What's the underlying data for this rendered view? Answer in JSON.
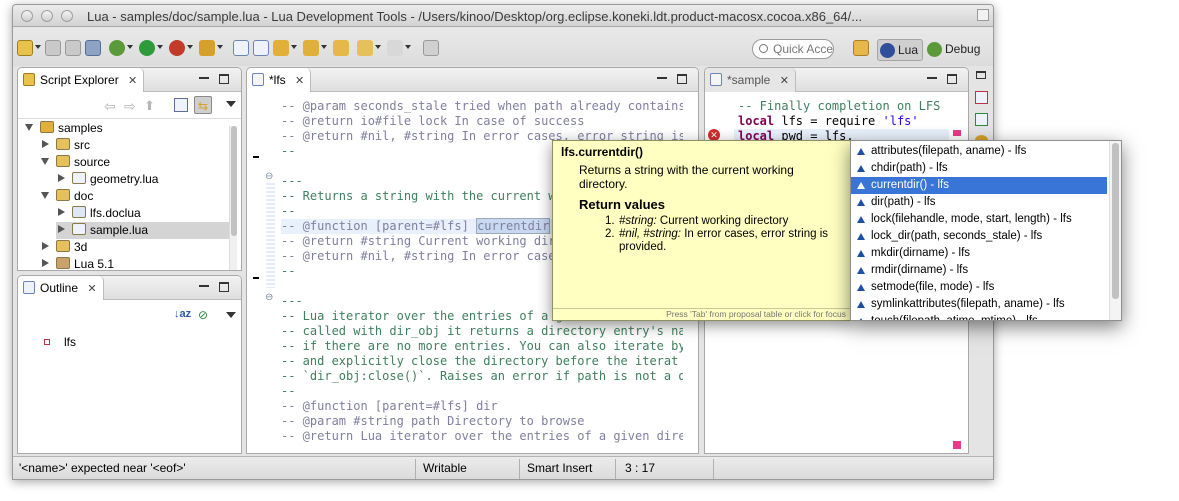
{
  "window": {
    "title": "Lua - samples/doc/sample.lua - Lua Development Tools - /Users/kinoo/Desktop/org.eclipse.koneki.ldt.product-macosx.cocoa.x86_64/..."
  },
  "toolbar": {
    "quick_access_placeholder": "Quick Acce",
    "perspectives": [
      {
        "label": "Lua",
        "icon": "lua-perspective-icon"
      },
      {
        "label": "Debug",
        "icon": "debug-bug-icon"
      }
    ]
  },
  "script_explorer": {
    "tab_label": "Script Explorer",
    "tree": [
      {
        "label": "samples",
        "depth": 0,
        "state": "open",
        "icon": "project-folder-icon"
      },
      {
        "label": "src",
        "depth": 1,
        "state": "closed",
        "icon": "source-folder-icon"
      },
      {
        "label": "source",
        "depth": 1,
        "state": "open",
        "icon": "source-folder-icon"
      },
      {
        "label": "geometry.lua",
        "depth": 2,
        "state": "closed",
        "icon": "lua-file-icon"
      },
      {
        "label": "doc",
        "depth": 1,
        "state": "open",
        "icon": "source-folder-icon"
      },
      {
        "label": "lfs.doclua",
        "depth": 2,
        "state": "closed",
        "icon": "doclua-file-icon"
      },
      {
        "label": "sample.lua",
        "depth": 2,
        "state": "closed",
        "icon": "lua-file-icon",
        "selected": true
      },
      {
        "label": "3d",
        "depth": 1,
        "state": "closed",
        "icon": "source-folder-icon"
      },
      {
        "label": "Lua 5.1",
        "depth": 1,
        "state": "closed",
        "icon": "library-icon"
      }
    ]
  },
  "outline": {
    "tab_label": "Outline",
    "items": [
      {
        "label": "lfs",
        "icon": "module-icon"
      }
    ]
  },
  "editor_left": {
    "tab_label": "*lfs",
    "lines": [
      "-- @param seconds_stale tried when path already contains",
      "-- @return io#file lock In case of success",
      "-- @return #nil, #string In error cases, error string is",
      "--",
      "",
      "---",
      "-- Returns a string with the current wo",
      "--",
      "-- @function [parent=#lfs] currentdir",
      "-- @return #string Current working dire",
      "-- @return #nil, #string In error cases",
      "--",
      "",
      "---",
      "-- Lua iterator over the entries of a g",
      "-- called with dir_obj it returns a directory entry's na",
      "-- if there are no more entries. You can also iterate by",
      "-- and explicitly close the directory before the iterat",
      "-- `dir_obj:close()`. Raises an error if path is not a d",
      "--",
      "-- @function [parent=#lfs] dir",
      "-- @param #string path Directory to browse",
      "-- @return Lua iterator over the entries of a given dire"
    ],
    "highlight_word": "currentdir"
  },
  "editor_right": {
    "tab_label": "*sample",
    "lines": [
      {
        "parts": [
          {
            "t": "-- Finally completion on LFS",
            "c": "cmt"
          }
        ]
      },
      {
        "parts": [
          {
            "t": "local",
            "c": "kw"
          },
          {
            "t": " lfs = require ",
            "c": ""
          },
          {
            "t": "'lfs'",
            "c": "str"
          }
        ]
      },
      {
        "parts": [
          {
            "t": "local",
            "c": "kw"
          },
          {
            "t": " pwd = lfs.",
            "c": ""
          }
        ]
      }
    ]
  },
  "hover_doc": {
    "title": "lfs.currentdir()",
    "description": "Returns a string with the current working directory.",
    "return_heading": "Return values",
    "returns": [
      {
        "num": "1.",
        "type": "#string:",
        "text": " Current working directory"
      },
      {
        "num": "2.",
        "type": "#nil, #string:",
        "text": " In error cases, error string is provided."
      }
    ],
    "footer": "Press 'Tab' from proposal table or click for focus"
  },
  "proposals": {
    "items": [
      "attributes(filepath, aname) - lfs",
      "chdir(path) - lfs",
      "currentdir() - lfs",
      "dir(path) - lfs",
      "lock(filehandle, mode, start, length) - lfs",
      "lock_dir(path, seconds_stale) - lfs",
      "mkdir(dirname) - lfs",
      "rmdir(dirname) - lfs",
      "setmode(file, mode) - lfs",
      "symlinkattributes(filepath, aname) - lfs",
      "touch(filepath, atime, mtime) - lfs"
    ],
    "selected_index": 2
  },
  "status_bar": {
    "message": "'<name>' expected near '<eof>'",
    "mode": "Writable",
    "insert_mode": "Smart Insert",
    "position": "3 : 17"
  },
  "colors": {
    "selection": "#3875d7",
    "hover_bg": "#ffffc1",
    "comment": "#3f7f5f",
    "keyword": "#7f0055",
    "string": "#2a00ff"
  }
}
